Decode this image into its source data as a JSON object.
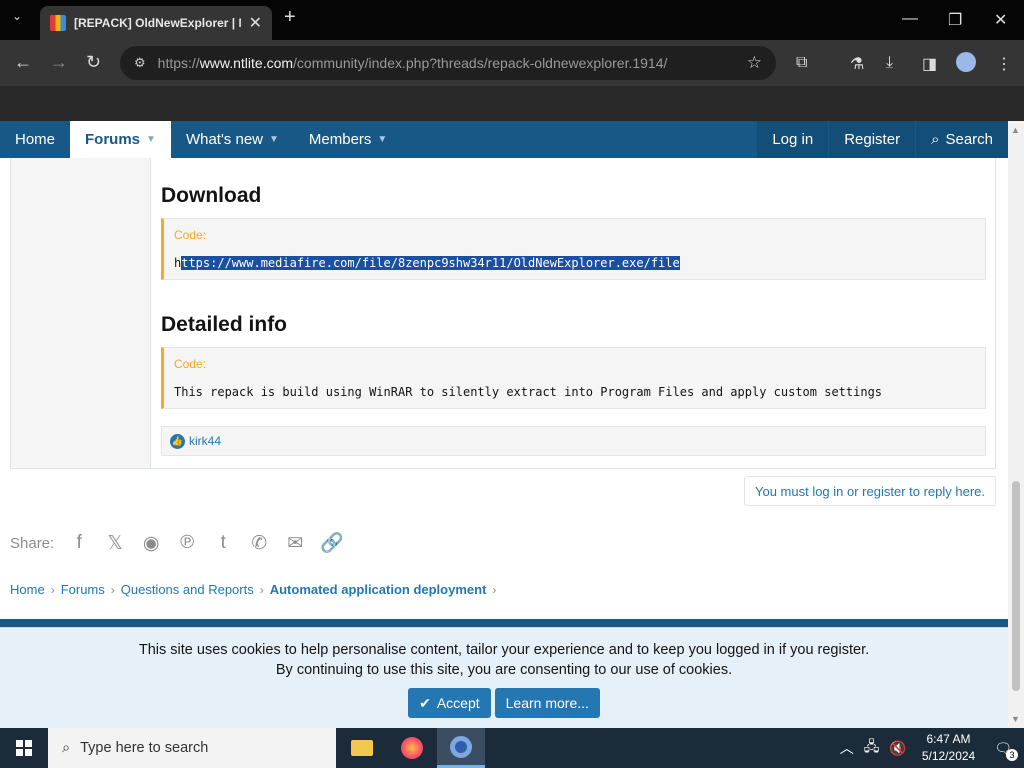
{
  "browser": {
    "tab_title": "[REPACK] OldNewExplorer | NT",
    "url_prefix": "https://",
    "url_domain": "www.ntlite.com",
    "url_path": "/community/index.php?threads/repack-oldnewexplorer.1914/"
  },
  "nav": {
    "home": "Home",
    "forums": "Forums",
    "whats_new": "What's new",
    "members": "Members",
    "login": "Log in",
    "register": "Register",
    "search": "Search"
  },
  "post": {
    "download_heading": "Download",
    "code_label": "Code:",
    "download_code_first": "h",
    "download_code_selected": "ttps://www.mediafire.com/file/8zenpc9shw34r11/OldNewExplorer.exe/file",
    "info_heading": "Detailed info",
    "info_code": "This repack is build using WinRAR to silently extract into Program Files and apply custom settings",
    "reaction_user": "kirk44"
  },
  "reply_note": "You must log in or register to reply here.",
  "share": {
    "label": "Share:",
    "icons": [
      "facebook-icon",
      "x-icon",
      "reddit-icon",
      "pinterest-icon",
      "tumblr-icon",
      "whatsapp-icon",
      "email-icon",
      "link-icon"
    ]
  },
  "breadcrumb": {
    "items": [
      "Home",
      "Forums",
      "Questions and Reports",
      "Automated application deployment"
    ]
  },
  "cookie": {
    "line1": "This site uses cookies to help personalise content, tailor your experience and to keep you logged in if you register.",
    "line2": "By continuing to use this site, you are consenting to our use of cookies.",
    "accept": "Accept",
    "learn_more": "Learn more..."
  },
  "taskbar": {
    "search_placeholder": "Type here to search",
    "time": "6:47 AM",
    "date": "5/12/2024",
    "notifications": "3"
  },
  "colors": {
    "nav_bg": "#185886",
    "link": "#2577b1",
    "code_accent": "#f9a825"
  }
}
